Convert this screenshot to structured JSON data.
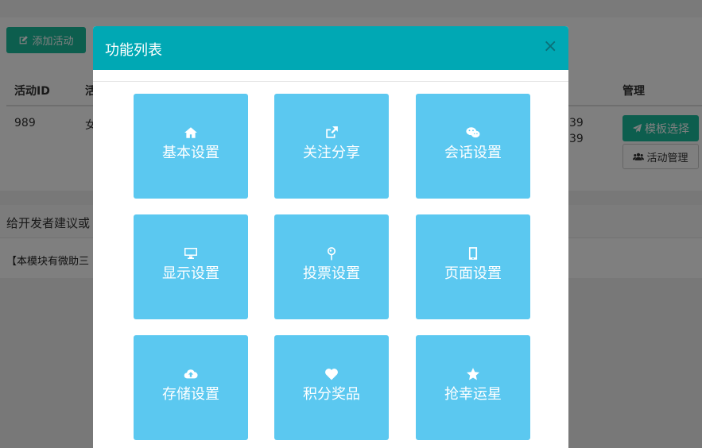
{
  "page": {
    "add_activity_label": "添加活动",
    "table": {
      "headers": {
        "id": "活动ID",
        "name": "活",
        "manage": "管理"
      },
      "row": {
        "id": "989",
        "name": "女",
        "time1": "39",
        "time2": "39"
      }
    },
    "template_select_label": "模板选择",
    "activity_manage_label": "活动管理",
    "feedback_title": "给开发者建议或",
    "module_notice": "【本模块有微助三"
  },
  "modal": {
    "title": "功能列表",
    "close": "×",
    "tiles": [
      {
        "label": "基本设置",
        "icon": "home-icon"
      },
      {
        "label": "关注分享",
        "icon": "share-square-icon"
      },
      {
        "label": "会话设置",
        "icon": "wechat-icon"
      },
      {
        "label": "显示设置",
        "icon": "desktop-icon"
      },
      {
        "label": "投票设置",
        "icon": "pin-icon"
      },
      {
        "label": "页面设置",
        "icon": "tablet-icon"
      },
      {
        "label": "存储设置",
        "icon": "cloud-upload-icon"
      },
      {
        "label": "积分奖品",
        "icon": "heart-icon"
      },
      {
        "label": "抢幸运星",
        "icon": "star-icon"
      }
    ]
  },
  "colors": {
    "modal_header": "#00a8b4",
    "tile": "#5bc8f0",
    "primary_button": "#1abc9c"
  }
}
